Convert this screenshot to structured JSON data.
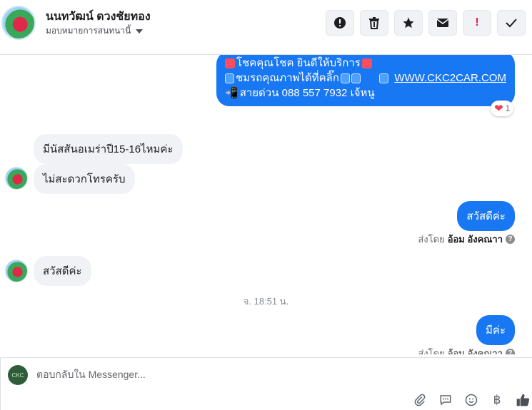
{
  "header": {
    "contact_name": "นนทวัฒน์ ดวงชัยทอง",
    "assign_label": "มอบหมายการสนทนานี้",
    "actions": [
      {
        "name": "follow-up-button",
        "icon": "alert-circle-icon",
        "glyph": "❗"
      },
      {
        "name": "delete-button",
        "icon": "trash-icon",
        "glyph": "🗑"
      },
      {
        "name": "star-button",
        "icon": "star-icon",
        "glyph": "★"
      },
      {
        "name": "mark-unread-button",
        "icon": "envelope-icon",
        "glyph": "✉"
      },
      {
        "name": "spam-button",
        "icon": "exclamation-icon",
        "glyph": "!"
      },
      {
        "name": "done-button",
        "icon": "check-icon",
        "glyph": "✓"
      }
    ]
  },
  "messages": {
    "promo": {
      "line1": "โชคคุณโชค ยินดีให้บริการ",
      "line2": "ชมรถคุณภาพได้ที่คลิ๊ก",
      "link": "WWW.CKC2CAR.COM",
      "line3": "สายด่วน 088 557 7932 เจ้หนู"
    },
    "reaction_count": "1",
    "in1": "มีนัสสันอเมร่าปี15-16ไหมค่ะ",
    "in2": "ไม่สะดวกโทรครับ",
    "out1": "สวัสดีค่ะ",
    "sent_by_label": "ส่งโดย",
    "sent_by_name": "อ้อม อังคณาา",
    "in3": "สวัสดีค่ะ",
    "timestamp": "จ. 18:51 น.",
    "out2": "มีค่ะ"
  },
  "composer": {
    "placeholder": "ตอบกลับใน Messenger...",
    "page_avatar_text": "CKC"
  },
  "colors": {
    "accent": "#1877f2",
    "incoming_bubble": "#f0f2f5",
    "reaction_heart": "#f33e58"
  }
}
